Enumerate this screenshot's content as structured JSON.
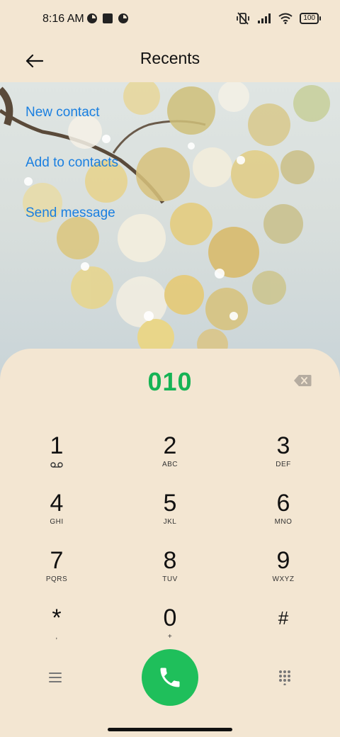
{
  "status_bar": {
    "time": "8:16 AM",
    "battery": "100",
    "icons": [
      "notification-circle-icon",
      "square-icon",
      "notification-circle-icon",
      "vibrate-off-icon",
      "signal-icon",
      "wifi-icon",
      "battery-icon"
    ]
  },
  "app_bar": {
    "title": "Recents",
    "back_icon": "back-arrow-icon"
  },
  "actions": {
    "new_contact": "New contact",
    "add_to_contacts": "Add to contacts",
    "send_message": "Send message"
  },
  "dialpad": {
    "number": "010",
    "keys": [
      {
        "digit": "1",
        "letters": ""
      },
      {
        "digit": "2",
        "letters": "ABC"
      },
      {
        "digit": "3",
        "letters": "DEF"
      },
      {
        "digit": "4",
        "letters": "GHI"
      },
      {
        "digit": "5",
        "letters": "JKL"
      },
      {
        "digit": "6",
        "letters": "MNO"
      },
      {
        "digit": "7",
        "letters": "PQRS"
      },
      {
        "digit": "8",
        "letters": "TUV"
      },
      {
        "digit": "9",
        "letters": "WXYZ"
      },
      {
        "digit": "*",
        "letters": ","
      },
      {
        "digit": "0",
        "letters": "+"
      },
      {
        "digit": "#",
        "letters": ""
      }
    ]
  },
  "colors": {
    "background": "#f3e6d2",
    "accent_link": "#1a7fe0",
    "number": "#16b355",
    "call": "#1fbf5b"
  }
}
